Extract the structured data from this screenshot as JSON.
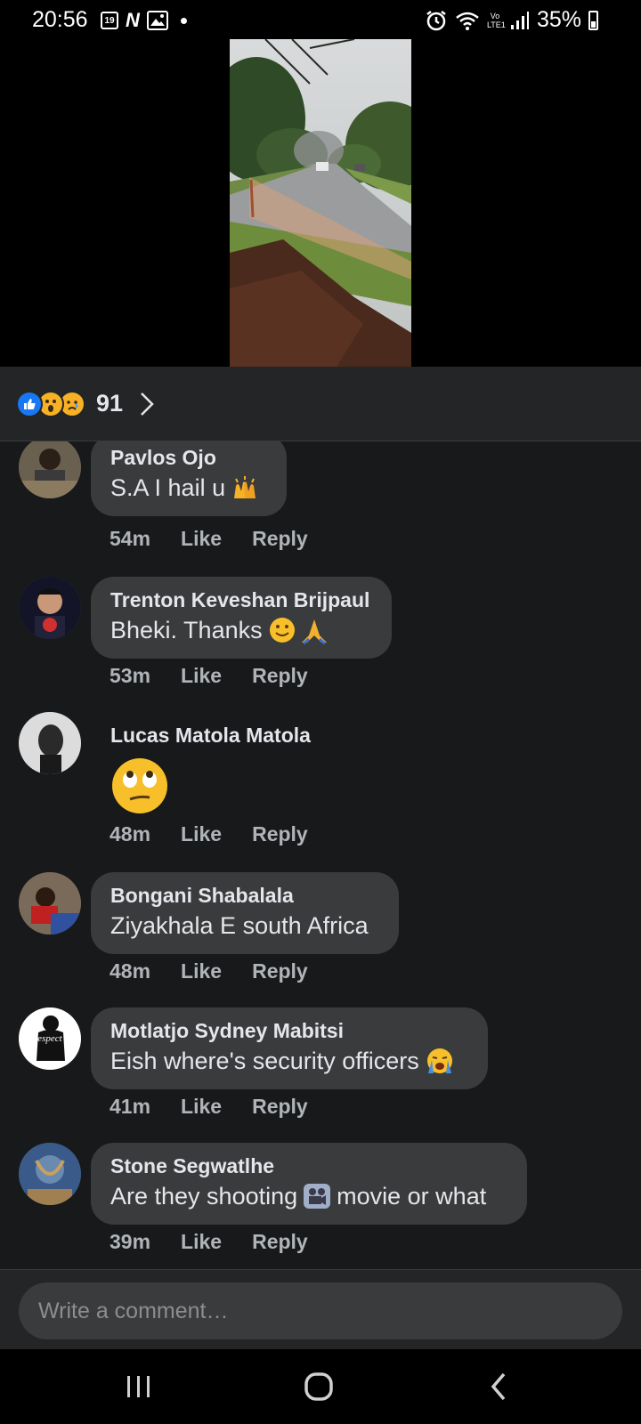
{
  "status_bar": {
    "time": "20:56",
    "calendar_day": "19",
    "network_label": "Vo LTE1",
    "battery": "35%"
  },
  "reactions": {
    "count": "91",
    "types": [
      "like-icon",
      "wow-icon",
      "sad-icon"
    ]
  },
  "comments": [
    {
      "name": "Pavlos Ojo",
      "text": "S.A I hail u",
      "emoji": "raised-hands-icon",
      "time": "54m",
      "like": "Like",
      "reply": "Reply"
    },
    {
      "name": "Trenton Keveshan Brijpaul",
      "text": "Bheki. Thanks",
      "emoji": "smile-pray-icon",
      "time": "53m",
      "like": "Like",
      "reply": "Reply"
    },
    {
      "name": "Lucas Matola Matola",
      "text": "",
      "emoji": "eye-roll-icon",
      "time": "48m",
      "like": "Like",
      "reply": "Reply"
    },
    {
      "name": "Bongani Shabalala",
      "text": "Ziyakhala E south Africa",
      "emoji": "",
      "time": "48m",
      "like": "Like",
      "reply": "Reply"
    },
    {
      "name": "Motlatjo Sydney Mabitsi",
      "text": "Eish where's security officers",
      "emoji": "crying-face-icon",
      "time": "41m",
      "like": "Like",
      "reply": "Reply"
    },
    {
      "name": "Stone Segwatlhe",
      "text_before": "Are they shooting",
      "text_after": "movie or what",
      "emoji": "movie-camera-icon",
      "time": "39m",
      "like": "Like",
      "reply": "Reply"
    }
  ],
  "comment_box": {
    "placeholder": "Write a comment…"
  },
  "colors": {
    "background": "#18191a",
    "bubble": "#3a3b3c",
    "accent": "#1877f2",
    "muted_text": "#b0b3b8"
  }
}
